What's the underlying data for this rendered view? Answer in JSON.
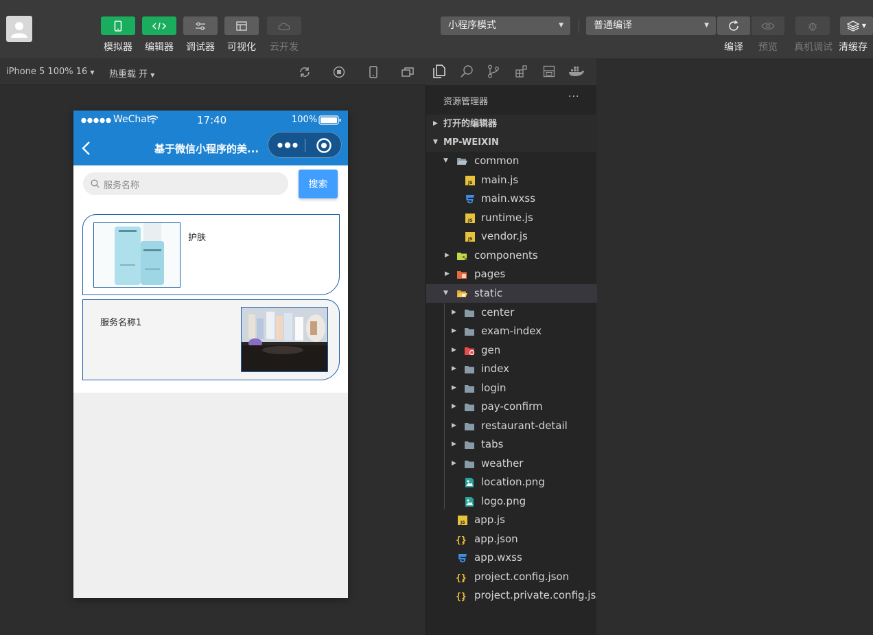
{
  "toolbar": {
    "buttons": [
      {
        "label": "模拟器"
      },
      {
        "label": "编辑器"
      },
      {
        "label": "调试器"
      },
      {
        "label": "可视化"
      },
      {
        "label": "云开发"
      }
    ],
    "mode_select": "小程序模式",
    "compile_select": "普通编译",
    "right_labels": [
      "编译",
      "预览",
      "真机调试",
      "清缓存"
    ]
  },
  "subbar": {
    "device": "iPhone 5 100% 16",
    "hot_reload": "热重载 开"
  },
  "phone": {
    "carrier": "WeChat",
    "time": "17:40",
    "battery": "100%",
    "nav_title": "基于微信小程序的美...",
    "search_placeholder": "服务名称",
    "search_button": "搜索",
    "cards": [
      {
        "title": "护肤"
      },
      {
        "title": "服务名称1"
      }
    ]
  },
  "explorer": {
    "header": "资源管理器",
    "more": "···",
    "open_editors": "打开的编辑器",
    "project": "MP-WEIXIN",
    "tree": [
      {
        "name": "common"
      },
      {
        "name": "main.js"
      },
      {
        "name": "main.wxss"
      },
      {
        "name": "runtime.js"
      },
      {
        "name": "vendor.js"
      },
      {
        "name": "components"
      },
      {
        "name": "pages"
      },
      {
        "name": "static"
      },
      {
        "name": "center"
      },
      {
        "name": "exam-index"
      },
      {
        "name": "gen"
      },
      {
        "name": "index"
      },
      {
        "name": "login"
      },
      {
        "name": "pay-confirm"
      },
      {
        "name": "restaurant-detail"
      },
      {
        "name": "tabs"
      },
      {
        "name": "weather"
      },
      {
        "name": "location.png"
      },
      {
        "name": "logo.png"
      },
      {
        "name": "app.js"
      },
      {
        "name": "app.json"
      },
      {
        "name": "app.wxss"
      },
      {
        "name": "project.config.json"
      },
      {
        "name": "project.private.config.js..."
      }
    ]
  }
}
